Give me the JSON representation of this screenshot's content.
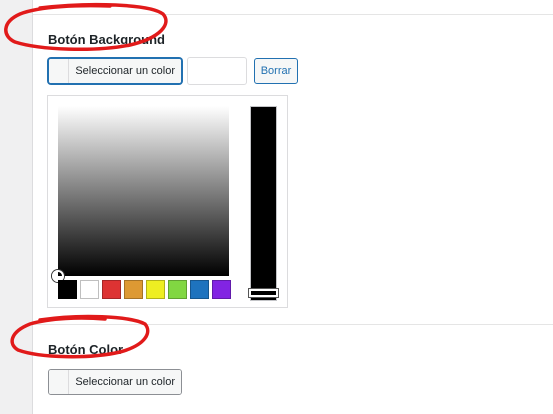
{
  "section_background": {
    "label": "Botón Background",
    "picker_button_label": "Seleccionar un color",
    "hex_value": "",
    "clear_label": "Borrar"
  },
  "palette": {
    "colors": [
      "#000000",
      "#ffffff",
      "#dd3333",
      "#dd9933",
      "#eeee22",
      "#81d742",
      "#1e73be",
      "#8224e3"
    ],
    "names": [
      "black-swatch",
      "white-swatch",
      "red-swatch",
      "orange-swatch",
      "yellow-swatch",
      "green-swatch",
      "blue-swatch",
      "purple-swatch"
    ]
  },
  "section_color": {
    "label": "Botón Color",
    "picker_button_label": "Seleccionar un color"
  },
  "accent_color": "#2271b1",
  "annotation_color": "#e11a1a"
}
